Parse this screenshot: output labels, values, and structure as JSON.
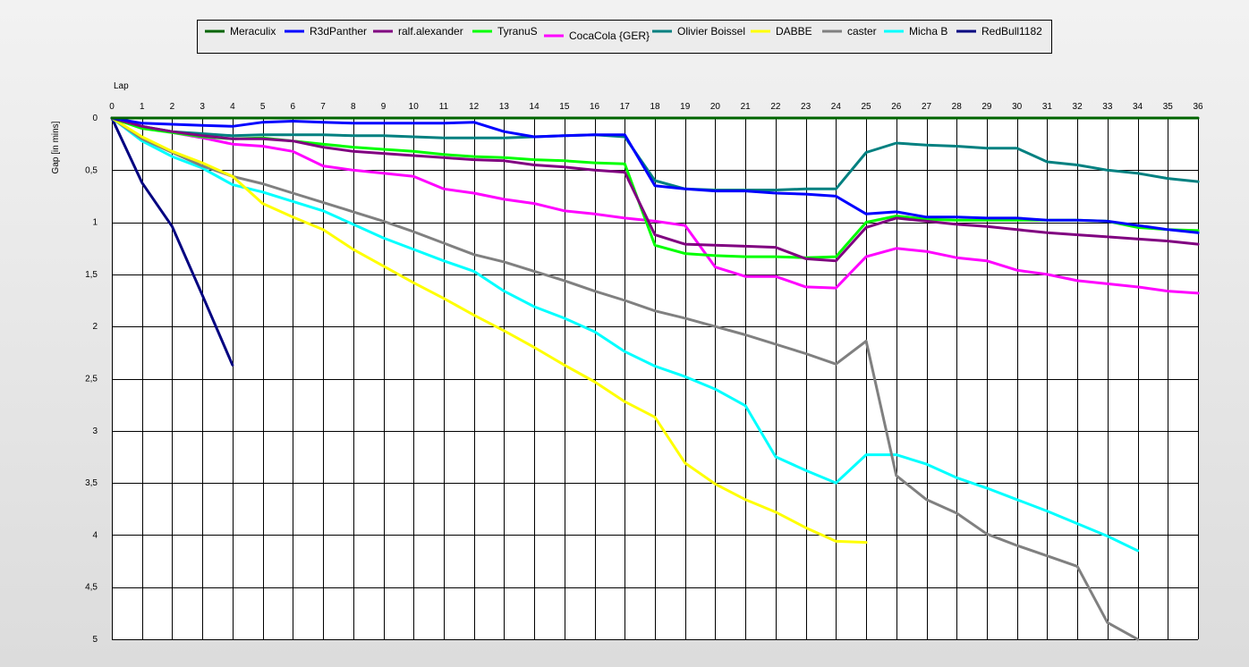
{
  "chart_data": {
    "type": "line",
    "title": "",
    "xlabel": "Lap",
    "ylabel": "Gap [in mins]",
    "x_axis_position": "top",
    "y_axis_inverted": true,
    "xlim": [
      0,
      36
    ],
    "ylim": [
      0,
      5
    ],
    "x_ticks": [
      "0",
      "1",
      "2",
      "3",
      "4",
      "5",
      "6",
      "7",
      "8",
      "9",
      "10",
      "11",
      "12",
      "13",
      "14",
      "15",
      "16",
      "17",
      "18",
      "19",
      "20",
      "21",
      "22",
      "23",
      "24",
      "25",
      "26",
      "27",
      "28",
      "29",
      "30",
      "31",
      "32",
      "33",
      "34",
      "35",
      "36"
    ],
    "y_ticks": [
      "0",
      "0,5",
      "1",
      "1,5",
      "2",
      "2,5",
      "3",
      "3,5",
      "4",
      "4,5",
      "5"
    ],
    "grid": true,
    "legend_position": "top",
    "series": [
      {
        "name": "Meraculix",
        "color": "#006400",
        "values": [
          0,
          0,
          0,
          0,
          0,
          0,
          0,
          0,
          0,
          0,
          0,
          0,
          0,
          0,
          0,
          0,
          0,
          0,
          0,
          0,
          0,
          0,
          0,
          0,
          0,
          0,
          0,
          0,
          0,
          0,
          0,
          0,
          0,
          0,
          0,
          0,
          0
        ]
      },
      {
        "name": "R3dPanther",
        "color": "#0000ff",
        "values": [
          0,
          0.05,
          0.06,
          0.07,
          0.08,
          0.04,
          0.03,
          0.04,
          0.05,
          0.05,
          0.05,
          0.05,
          0.04,
          0.13,
          0.18,
          0.17,
          0.16,
          0.16,
          0.65,
          0.68,
          0.7,
          0.7,
          0.72,
          0.73,
          0.75,
          0.92,
          0.9,
          0.95,
          0.95,
          0.96,
          0.96,
          0.98,
          0.98,
          0.99,
          1.03,
          1.07,
          1.1
        ]
      },
      {
        "name": "ralf.alexander",
        "color": "#800080",
        "values": [
          0,
          0.08,
          0.13,
          0.17,
          0.2,
          0.2,
          0.22,
          0.28,
          0.32,
          0.34,
          0.36,
          0.38,
          0.4,
          0.41,
          0.45,
          0.47,
          0.5,
          0.52,
          1.12,
          1.21,
          1.22,
          1.23,
          1.24,
          1.35,
          1.37,
          1.05,
          0.96,
          0.99,
          1.02,
          1.04,
          1.07,
          1.1,
          1.12,
          1.14,
          1.16,
          1.18,
          1.21
        ]
      },
      {
        "name": "TyranuS",
        "color": "#00ff00",
        "values": [
          0,
          0.1,
          0.14,
          0.18,
          0.2,
          0.19,
          0.22,
          0.25,
          0.28,
          0.3,
          0.32,
          0.35,
          0.37,
          0.38,
          0.4,
          0.41,
          0.43,
          0.44,
          1.22,
          1.3,
          1.32,
          1.33,
          1.33,
          1.34,
          1.33,
          1.0,
          0.94,
          0.97,
          0.98,
          0.98,
          0.98,
          0.98,
          0.98,
          0.99,
          1.05,
          1.07,
          1.08
        ]
      },
      {
        "name": "CocaCola {GER}",
        "color": "#ff00ff",
        "values": [
          0,
          0.08,
          0.14,
          0.19,
          0.25,
          0.27,
          0.32,
          0.46,
          0.5,
          0.53,
          0.56,
          0.68,
          0.72,
          0.78,
          0.82,
          0.89,
          0.92,
          0.96,
          0.99,
          1.03,
          1.43,
          1.52,
          1.52,
          1.62,
          1.63,
          1.33,
          1.25,
          1.28,
          1.34,
          1.37,
          1.46,
          1.5,
          1.56,
          1.59,
          1.62,
          1.66,
          1.68
        ]
      },
      {
        "name": "Olivier Boissel",
        "color": "#008080",
        "values": [
          0,
          0.08,
          0.13,
          0.15,
          0.17,
          0.16,
          0.16,
          0.16,
          0.17,
          0.17,
          0.18,
          0.19,
          0.19,
          0.19,
          0.18,
          0.17,
          0.16,
          0.18,
          0.6,
          0.68,
          0.69,
          0.69,
          0.69,
          0.68,
          0.68,
          0.33,
          0.24,
          0.26,
          0.27,
          0.29,
          0.29,
          0.42,
          0.45,
          0.5,
          0.53,
          0.58,
          0.61
        ]
      },
      {
        "name": "DABBE",
        "color": "#ffff00",
        "values": [
          0,
          0.18,
          0.32,
          0.43,
          0.56,
          0.82,
          0.95,
          1.07,
          1.26,
          1.42,
          1.58,
          1.73,
          1.89,
          2.04,
          2.2,
          2.37,
          2.53,
          2.72,
          2.87,
          3.31,
          3.51,
          3.66,
          3.78,
          3.93,
          4.06,
          4.07
        ]
      },
      {
        "name": "caster",
        "color": "#808080",
        "values": [
          0,
          0.2,
          0.33,
          0.46,
          0.56,
          0.63,
          0.72,
          0.81,
          0.9,
          0.99,
          1.09,
          1.2,
          1.31,
          1.38,
          1.47,
          1.56,
          1.66,
          1.75,
          1.85,
          1.92,
          2.0,
          2.08,
          2.17,
          2.26,
          2.36,
          2.14,
          3.43,
          3.66,
          3.79,
          3.99,
          4.1,
          4.2,
          4.3,
          4.84,
          5.0
        ]
      },
      {
        "name": "Micha B",
        "color": "#00ffff",
        "values": [
          0,
          0.22,
          0.37,
          0.48,
          0.64,
          0.71,
          0.8,
          0.89,
          1.02,
          1.15,
          1.26,
          1.37,
          1.47,
          1.66,
          1.81,
          1.92,
          2.05,
          2.24,
          2.38,
          2.48,
          2.6,
          2.76,
          3.25,
          3.38,
          3.5,
          3.23,
          3.23,
          3.32,
          3.45,
          3.55,
          3.66,
          3.77,
          3.89,
          4.01,
          4.15
        ]
      },
      {
        "name": "RedBull1182",
        "color": "#000080",
        "values": [
          0,
          0.62,
          1.04,
          1.7,
          2.37
        ]
      }
    ]
  }
}
